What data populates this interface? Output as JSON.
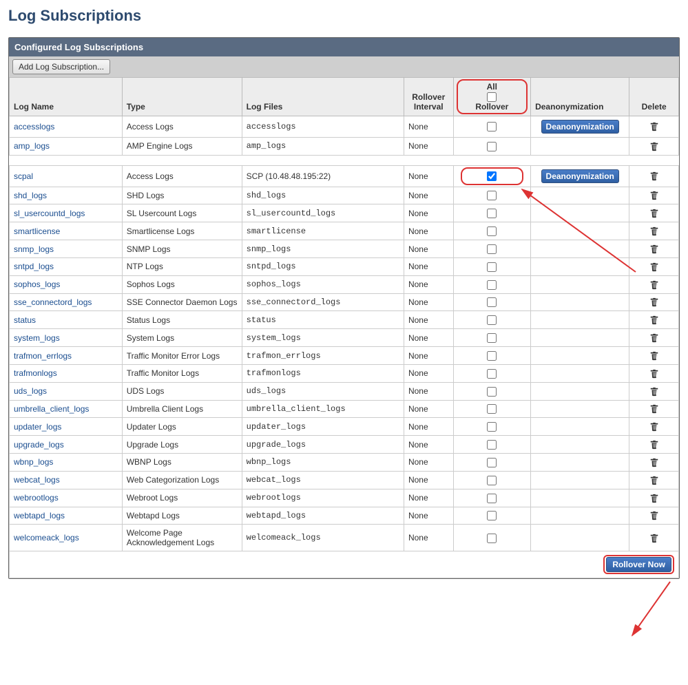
{
  "page": {
    "title": "Log Subscriptions"
  },
  "panel": {
    "header": "Configured Log Subscriptions"
  },
  "toolbar": {
    "add_btn": "Add Log Subscription..."
  },
  "headers": {
    "log_name": "Log Name",
    "type": "Type",
    "log_files": "Log Files",
    "rollover_interval": "Rollover Interval",
    "all": "All",
    "rollover": "Rollover",
    "deanon": "Deanonymization",
    "delete": "Delete"
  },
  "deanon_btn": "Deanonymization",
  "rollover_now_btn": "Rollover Now",
  "rows1": [
    {
      "name": "accesslogs",
      "type": "Access Logs",
      "files": "accesslogs",
      "mono": true,
      "interval": "None",
      "checked": false,
      "deanon": true
    },
    {
      "name": "amp_logs",
      "type": "AMP Engine Logs",
      "files": "amp_logs",
      "mono": true,
      "interval": "None",
      "checked": false,
      "deanon": false
    }
  ],
  "rows2": [
    {
      "name": "scpal",
      "type": "Access Logs",
      "files": "SCP (10.48.48.195:22)",
      "mono": false,
      "interval": "None",
      "checked": true,
      "deanon": true,
      "highlight": true
    },
    {
      "name": "shd_logs",
      "type": "SHD Logs",
      "files": "shd_logs",
      "mono": true,
      "interval": "None",
      "checked": false,
      "deanon": false
    },
    {
      "name": "sl_usercountd_logs",
      "type": "SL Usercount Logs",
      "files": "sl_usercountd_logs",
      "mono": true,
      "interval": "None",
      "checked": false,
      "deanon": false
    },
    {
      "name": "smartlicense",
      "type": "Smartlicense Logs",
      "files": "smartlicense",
      "mono": true,
      "interval": "None",
      "checked": false,
      "deanon": false
    },
    {
      "name": "snmp_logs",
      "type": "SNMP Logs",
      "files": "snmp_logs",
      "mono": true,
      "interval": "None",
      "checked": false,
      "deanon": false
    },
    {
      "name": "sntpd_logs",
      "type": "NTP Logs",
      "files": "sntpd_logs",
      "mono": true,
      "interval": "None",
      "checked": false,
      "deanon": false
    },
    {
      "name": "sophos_logs",
      "type": "Sophos Logs",
      "files": "sophos_logs",
      "mono": true,
      "interval": "None",
      "checked": false,
      "deanon": false
    },
    {
      "name": "sse_connectord_logs",
      "type": "SSE Connector Daemon Logs",
      "files": "sse_connectord_logs",
      "mono": true,
      "interval": "None",
      "checked": false,
      "deanon": false
    },
    {
      "name": "status",
      "type": "Status Logs",
      "files": "status",
      "mono": true,
      "interval": "None",
      "checked": false,
      "deanon": false
    },
    {
      "name": "system_logs",
      "type": "System Logs",
      "files": "system_logs",
      "mono": true,
      "interval": "None",
      "checked": false,
      "deanon": false
    },
    {
      "name": "trafmon_errlogs",
      "type": "Traffic Monitor Error Logs",
      "files": "trafmon_errlogs",
      "mono": true,
      "interval": "None",
      "checked": false,
      "deanon": false
    },
    {
      "name": "trafmonlogs",
      "type": "Traffic Monitor Logs",
      "files": "trafmonlogs",
      "mono": true,
      "interval": "None",
      "checked": false,
      "deanon": false
    },
    {
      "name": "uds_logs",
      "type": "UDS Logs",
      "files": "uds_logs",
      "mono": true,
      "interval": "None",
      "checked": false,
      "deanon": false
    },
    {
      "name": "umbrella_client_logs",
      "type": "Umbrella Client Logs",
      "files": "umbrella_client_logs",
      "mono": true,
      "interval": "None",
      "checked": false,
      "deanon": false
    },
    {
      "name": "updater_logs",
      "type": "Updater Logs",
      "files": "updater_logs",
      "mono": true,
      "interval": "None",
      "checked": false,
      "deanon": false
    },
    {
      "name": "upgrade_logs",
      "type": "Upgrade Logs",
      "files": "upgrade_logs",
      "mono": true,
      "interval": "None",
      "checked": false,
      "deanon": false
    },
    {
      "name": "wbnp_logs",
      "type": "WBNP Logs",
      "files": "wbnp_logs",
      "mono": true,
      "interval": "None",
      "checked": false,
      "deanon": false
    },
    {
      "name": "webcat_logs",
      "type": "Web Categorization Logs",
      "files": "webcat_logs",
      "mono": true,
      "interval": "None",
      "checked": false,
      "deanon": false
    },
    {
      "name": "webrootlogs",
      "type": "Webroot Logs",
      "files": "webrootlogs",
      "mono": true,
      "interval": "None",
      "checked": false,
      "deanon": false
    },
    {
      "name": "webtapd_logs",
      "type": "Webtapd Logs",
      "files": "webtapd_logs",
      "mono": true,
      "interval": "None",
      "checked": false,
      "deanon": false
    },
    {
      "name": "welcomeack_logs",
      "type": "Welcome Page Acknowledgement Logs",
      "files": "welcomeack_logs",
      "mono": true,
      "interval": "None",
      "checked": false,
      "deanon": false
    }
  ]
}
